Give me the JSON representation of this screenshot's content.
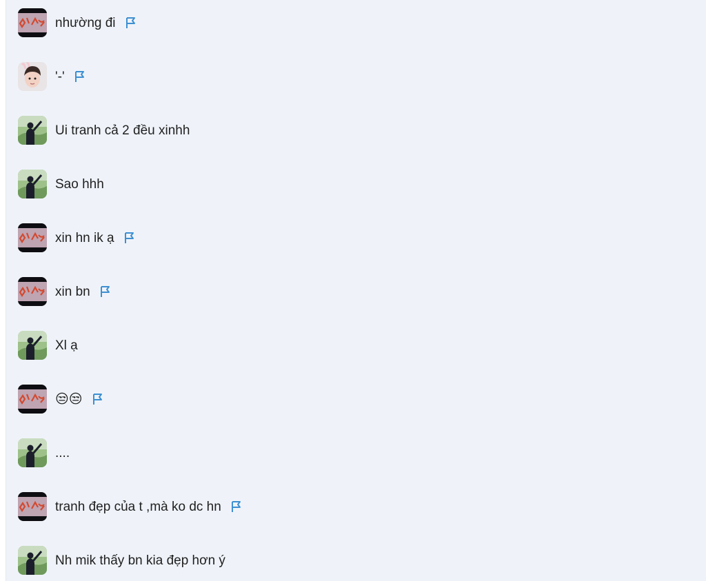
{
  "messages": [
    {
      "avatar": "dark-red-avatar",
      "text": "nhường đi",
      "flag": true
    },
    {
      "avatar": "bunny-girl-avatar",
      "text": "'-'",
      "flag": true
    },
    {
      "avatar": "green-landscape-avatar",
      "text": "Ui tranh cả 2 đều xinhh",
      "flag": false
    },
    {
      "avatar": "green-landscape-avatar",
      "text": "Sao hhh",
      "flag": false
    },
    {
      "avatar": "dark-red-avatar",
      "text": "xin hn ik ạ",
      "flag": true
    },
    {
      "avatar": "dark-red-avatar",
      "text": "xin bn",
      "flag": true
    },
    {
      "avatar": "green-landscape-avatar",
      "text": "Xl ạ",
      "flag": false
    },
    {
      "avatar": "dark-red-avatar",
      "text": "😒😒",
      "flag": true
    },
    {
      "avatar": "green-landscape-avatar",
      "text": "....",
      "flag": false
    },
    {
      "avatar": "dark-red-avatar",
      "text": "tranh đẹp của t ,mà ko dc hn",
      "flag": true
    },
    {
      "avatar": "green-landscape-avatar",
      "text": "Nh mik thấy bn kia đẹp hơn ý",
      "flag": false
    }
  ],
  "icons": {
    "flag": "flag-icon",
    "emoji": "unamused-face-emoji"
  },
  "colors": {
    "background": "#eff3f9",
    "text": "#1f1f1f",
    "flag": "#3d8fd1"
  }
}
